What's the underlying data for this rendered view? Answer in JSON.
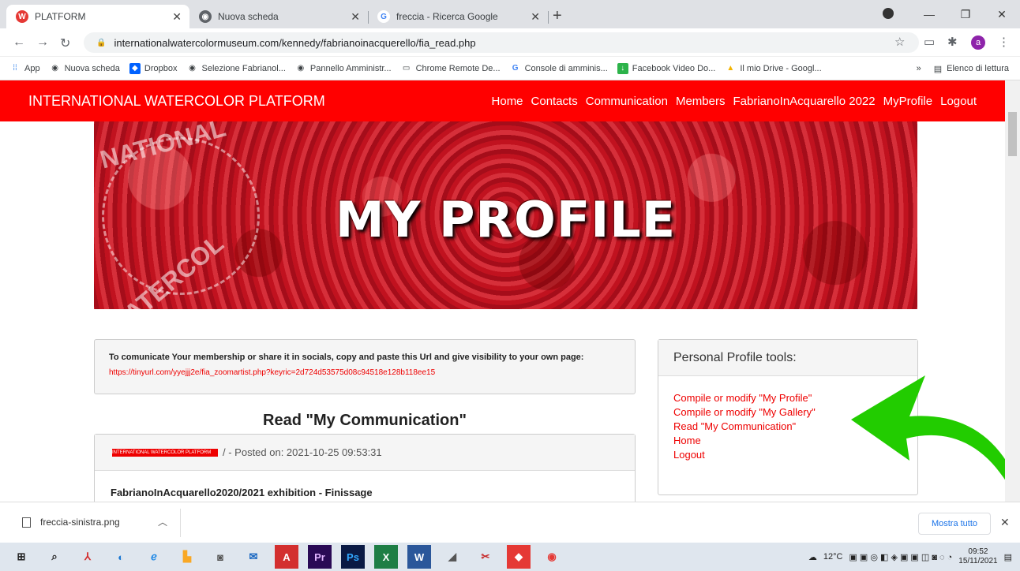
{
  "browser": {
    "tabs": [
      {
        "label": "PLATFORM",
        "icon": "W",
        "color": "#e53935"
      },
      {
        "label": "Nuova scheda",
        "icon": "globe",
        "color": "#5f6368"
      },
      {
        "label": "freccia - Ricerca Google",
        "icon": "G",
        "color": "#4285f4"
      }
    ],
    "url": "internationalwatercolormuseum.com/kennedy/fabrianoinacquerello/fia_read.php",
    "avatar": "a",
    "bookmarks": [
      "App",
      "Nuova scheda",
      "Dropbox",
      "Selezione Fabrianol...",
      "Pannello Amministr...",
      "Chrome Remote De...",
      "Console di amminis...",
      "Facebook Video Do...",
      "Il mio Drive - Googl..."
    ],
    "bookmarks_more": "»",
    "reading_list": "Elenco di lettura"
  },
  "site": {
    "brand": "INTERNATIONAL WATERCOLOR PLATFORM",
    "nav": [
      "Home",
      "Contacts",
      "Communication",
      "Members",
      "FabrianoInAcquarello 2022",
      "MyProfile",
      "Logout"
    ],
    "banner_title": "MY PROFILE",
    "banner_watermark": [
      "NATIONAL",
      "WATERCOL"
    ],
    "notice_text": "To comunicate Your membership or share it in socials, copy and paste this Url and give visibility to your own page:",
    "notice_link": "https://tinyurl.com/yyejjj2e/fia_zoomartist.php?keyric=2d724d53575d08c94518e128b118ee15",
    "read_title": "Read \"My Communication\"",
    "post_badge": "INTERNATIONAL WATERCOLOR PLATFORM",
    "post_meta": "/ - Posted on: 2021-10-25 09:53:31",
    "post_title": "FabrianoInAcquarello2020/2021 exhibition - Finissage",
    "tools_title": "Personal Profile tools:",
    "tools": [
      "Compile or modify \"My Profile\"",
      "Compile or modify \"My Gallery\"",
      "Read \"My Communication\"",
      "Home",
      "Logout"
    ],
    "accent": "#ff0000",
    "arrow_color": "#22cc00"
  },
  "downloads": {
    "file": "freccia-sinistra.png",
    "show_all": "Mostra tutto"
  },
  "taskbar": {
    "temp": "12°C",
    "time": "09:52",
    "date": "15/11/2021"
  }
}
